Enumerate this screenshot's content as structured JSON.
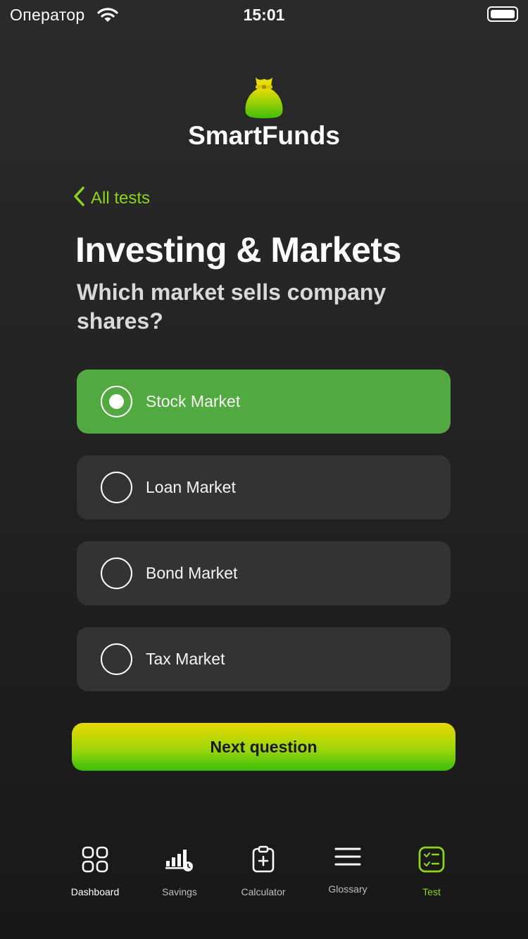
{
  "status_bar": {
    "carrier": "Оператор",
    "time": "15:01"
  },
  "app": {
    "title": "SmartFunds"
  },
  "nav": {
    "back_label": "All tests"
  },
  "test": {
    "category": "Investing & Markets",
    "question": "Which market sells company shares?"
  },
  "options": [
    {
      "label": "Stock Market",
      "selected": true
    },
    {
      "label": "Loan Market",
      "selected": false
    },
    {
      "label": "Bond Market",
      "selected": false
    },
    {
      "label": "Tax Market",
      "selected": false
    }
  ],
  "next_button": {
    "label": "Next question"
  },
  "tabs": [
    {
      "label": "Dashboard",
      "icon": "grid-icon"
    },
    {
      "label": "Savings",
      "icon": "bar-chart-clock-icon"
    },
    {
      "label": "Calculator",
      "icon": "clipboard-plus-icon"
    },
    {
      "label": "Glossary",
      "icon": "menu-lines-icon"
    },
    {
      "label": "Test",
      "icon": "checklist-icon"
    }
  ],
  "colors": {
    "accent": "#8fd31a",
    "selected_option": "#52a93f",
    "option_bg": "#333333",
    "button_gradient": [
      "#e8d800",
      "#39bf08"
    ]
  }
}
